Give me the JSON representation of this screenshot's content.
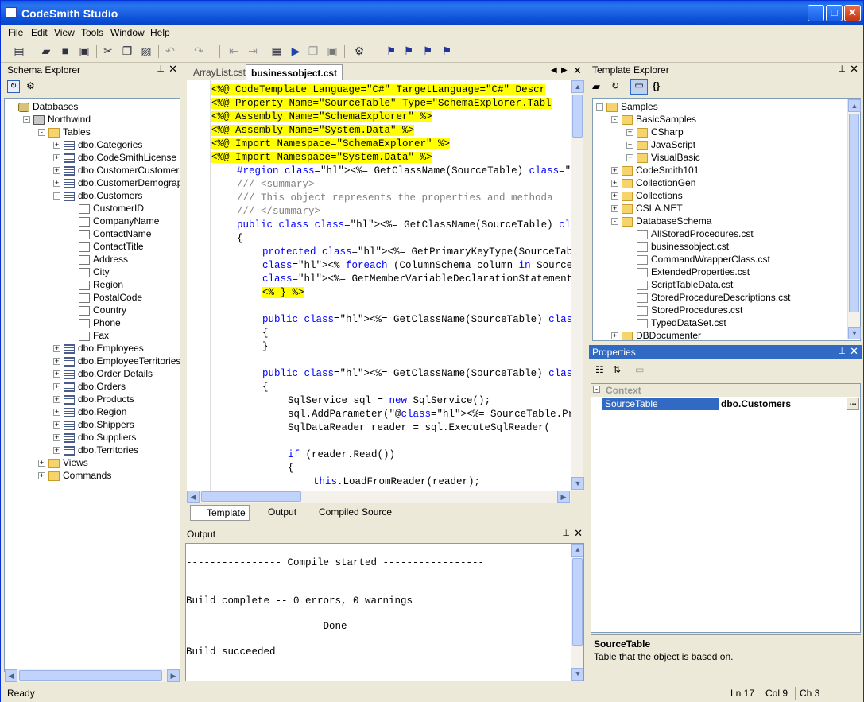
{
  "app": {
    "title": "CodeSmith Studio"
  },
  "menu": [
    "File",
    "Edit",
    "View",
    "Tools",
    "Window",
    "Help"
  ],
  "schema_explorer": {
    "title": "Schema Explorer",
    "tree": [
      {
        "label": "Databases",
        "level": 0,
        "icon": "db",
        "exp": ""
      },
      {
        "label": "Northwind",
        "level": 1,
        "icon": "srv",
        "exp": "-"
      },
      {
        "label": "Tables",
        "level": 2,
        "icon": "folder",
        "exp": "-"
      },
      {
        "label": "dbo.Categories",
        "level": 3,
        "icon": "table",
        "exp": "+"
      },
      {
        "label": "dbo.CodeSmithLicense",
        "level": 3,
        "icon": "table",
        "exp": "+"
      },
      {
        "label": "dbo.CustomerCustomerDemo",
        "level": 3,
        "icon": "table",
        "exp": "+"
      },
      {
        "label": "dbo.CustomerDemographics",
        "level": 3,
        "icon": "table",
        "exp": "+"
      },
      {
        "label": "dbo.Customers",
        "level": 3,
        "icon": "table",
        "exp": "-"
      },
      {
        "label": "CustomerID",
        "level": 4,
        "icon": "col",
        "exp": ""
      },
      {
        "label": "CompanyName",
        "level": 4,
        "icon": "col",
        "exp": ""
      },
      {
        "label": "ContactName",
        "level": 4,
        "icon": "col",
        "exp": ""
      },
      {
        "label": "ContactTitle",
        "level": 4,
        "icon": "col",
        "exp": ""
      },
      {
        "label": "Address",
        "level": 4,
        "icon": "col",
        "exp": ""
      },
      {
        "label": "City",
        "level": 4,
        "icon": "col",
        "exp": ""
      },
      {
        "label": "Region",
        "level": 4,
        "icon": "col",
        "exp": ""
      },
      {
        "label": "PostalCode",
        "level": 4,
        "icon": "col",
        "exp": ""
      },
      {
        "label": "Country",
        "level": 4,
        "icon": "col",
        "exp": ""
      },
      {
        "label": "Phone",
        "level": 4,
        "icon": "col",
        "exp": ""
      },
      {
        "label": "Fax",
        "level": 4,
        "icon": "col",
        "exp": ""
      },
      {
        "label": "dbo.Employees",
        "level": 3,
        "icon": "table",
        "exp": "+"
      },
      {
        "label": "dbo.EmployeeTerritories",
        "level": 3,
        "icon": "table",
        "exp": "+"
      },
      {
        "label": "dbo.Order Details",
        "level": 3,
        "icon": "table",
        "exp": "+"
      },
      {
        "label": "dbo.Orders",
        "level": 3,
        "icon": "table",
        "exp": "+"
      },
      {
        "label": "dbo.Products",
        "level": 3,
        "icon": "table",
        "exp": "+"
      },
      {
        "label": "dbo.Region",
        "level": 3,
        "icon": "table",
        "exp": "+"
      },
      {
        "label": "dbo.Shippers",
        "level": 3,
        "icon": "table",
        "exp": "+"
      },
      {
        "label": "dbo.Suppliers",
        "level": 3,
        "icon": "table",
        "exp": "+"
      },
      {
        "label": "dbo.Territories",
        "level": 3,
        "icon": "table",
        "exp": "+"
      },
      {
        "label": "Views",
        "level": 2,
        "icon": "folder",
        "exp": "+"
      },
      {
        "label": "Commands",
        "level": 2,
        "icon": "folder",
        "exp": "+"
      }
    ]
  },
  "editor": {
    "tabs": [
      "ArrayList.cst",
      "businessobject.cst"
    ],
    "active_tab": "businessobject.cst",
    "bottom_tabs": [
      "Template",
      "Output",
      "Compiled Source"
    ],
    "lines": [
      {
        "t": "<%@ CodeTemplate Language=\"C#\" TargetLanguage=\"C#\" Descr",
        "s": "hl",
        "i": 0
      },
      {
        "t": "<%@ Property Name=\"SourceTable\" Type=\"SchemaExplorer.Tabl",
        "s": "hl",
        "i": 0
      },
      {
        "t": "<%@ Assembly Name=\"SchemaExplorer\" %>",
        "s": "hl",
        "i": 0
      },
      {
        "t": "<%@ Assembly Name=\"System.Data\" %>",
        "s": "hl",
        "i": 0
      },
      {
        "t": "<%@ Import Namespace=\"SchemaExplorer\" %>",
        "s": "hl",
        "i": 0
      },
      {
        "t": "<%@ Import Namespace=\"System.Data\" %>",
        "s": "hl",
        "i": 0
      },
      {
        "t": "#region <%= GetClassName(SourceTable) %>",
        "s": "region",
        "i": 1
      },
      {
        "t": "/// <summary>",
        "s": "cm",
        "i": 1
      },
      {
        "t": "/// This object represents the properties and methoda",
        "s": "cm",
        "i": 1
      },
      {
        "t": "/// </summary>",
        "s": "cm",
        "i": 1
      },
      {
        "t": "public class <%= GetClassName(SourceTable) %>",
        "s": "cls",
        "i": 1
      },
      {
        "t": "{",
        "s": "",
        "i": 1
      },
      {
        "t": "protected <%= GetPrimaryKeyType(SourceTable) %> _",
        "s": "prot",
        "i": 2
      },
      {
        "t": "<% foreach (ColumnSchema column in SourceTable.No",
        "s": "fe",
        "i": 2
      },
      {
        "t": "<%= GetMemberVariableDeclarationStatement(column",
        "s": "gm",
        "i": 2
      },
      {
        "t": "<% } %>",
        "s": "hl",
        "i": 2
      },
      {
        "t": "",
        "s": "",
        "i": 2
      },
      {
        "t": "public <%= GetClassName(SourceTable) %>()",
        "s": "ctor",
        "i": 2
      },
      {
        "t": "{",
        "s": "",
        "i": 2
      },
      {
        "t": "}",
        "s": "",
        "i": 2
      },
      {
        "t": "",
        "s": "",
        "i": 2
      },
      {
        "t": "public <%= GetClassName(SourceTable) %>(<%= GetP",
        "s": "ctor2",
        "i": 2
      },
      {
        "t": "{",
        "s": "",
        "i": 2
      },
      {
        "t": "SqlService sql = new SqlService();",
        "s": "sql",
        "i": 3
      },
      {
        "t": "sql.AddParameter(\"@<%= SourceTable.PrimaryKey",
        "s": "add",
        "i": 3
      },
      {
        "t": "SqlDataReader reader = sql.ExecuteSqlReader(",
        "s": "",
        "i": 3
      },
      {
        "t": "",
        "s": "",
        "i": 3
      },
      {
        "t": "if (reader.Read())",
        "s": "if",
        "i": 3
      },
      {
        "t": "{",
        "s": "",
        "i": 3
      },
      {
        "t": "this.LoadFromReader(reader);",
        "s": "this",
        "i": 4
      }
    ]
  },
  "output": {
    "title": "Output",
    "lines": [
      "",
      "---------------- Compile started -----------------",
      "",
      "",
      "Build complete -- 0 errors, 0 warnings",
      "",
      "---------------------- Done ----------------------",
      "",
      "Build succeeded"
    ]
  },
  "template_explorer": {
    "title": "Template Explorer",
    "tree": [
      {
        "label": "Samples",
        "level": 0,
        "icon": "folder",
        "exp": "-"
      },
      {
        "label": "BasicSamples",
        "level": 1,
        "icon": "folder",
        "exp": "-"
      },
      {
        "label": "CSharp",
        "level": 2,
        "icon": "folder",
        "exp": "+"
      },
      {
        "label": "JavaScript",
        "level": 2,
        "icon": "folder",
        "exp": "+"
      },
      {
        "label": "VisualBasic",
        "level": 2,
        "icon": "folder",
        "exp": "+"
      },
      {
        "label": "CodeSmith101",
        "level": 1,
        "icon": "folder",
        "exp": "+"
      },
      {
        "label": "CollectionGen",
        "level": 1,
        "icon": "folder",
        "exp": "+"
      },
      {
        "label": "Collections",
        "level": 1,
        "icon": "folder",
        "exp": "+"
      },
      {
        "label": "CSLA.NET",
        "level": 1,
        "icon": "folder",
        "exp": "+"
      },
      {
        "label": "DatabaseSchema",
        "level": 1,
        "icon": "folder",
        "exp": "-"
      },
      {
        "label": "AllStoredProcedures.cst",
        "level": 2,
        "icon": "cst",
        "exp": ""
      },
      {
        "label": "businessobject.cst",
        "level": 2,
        "icon": "cst",
        "exp": ""
      },
      {
        "label": "CommandWrapperClass.cst",
        "level": 2,
        "icon": "cst",
        "exp": ""
      },
      {
        "label": "ExtendedProperties.cst",
        "level": 2,
        "icon": "cst",
        "exp": ""
      },
      {
        "label": "ScriptTableData.cst",
        "level": 2,
        "icon": "cst",
        "exp": ""
      },
      {
        "label": "StoredProcedureDescriptions.cst",
        "level": 2,
        "icon": "cst",
        "exp": ""
      },
      {
        "label": "StoredProcedures.cst",
        "level": 2,
        "icon": "cst",
        "exp": ""
      },
      {
        "label": "TypedDataSet.cst",
        "level": 2,
        "icon": "cst",
        "exp": ""
      },
      {
        "label": "DBDocumenter",
        "level": 1,
        "icon": "folder",
        "exp": "+"
      }
    ]
  },
  "properties": {
    "title": "Properties",
    "category": "Context",
    "prop_name": "SourceTable",
    "prop_value": "dbo.Customers",
    "desc_title": "SourceTable",
    "desc_text": "Table that the object is based on."
  },
  "status": {
    "ready": "Ready",
    "ln": "Ln 17",
    "col": "Col 9",
    "ch": "Ch 3"
  }
}
